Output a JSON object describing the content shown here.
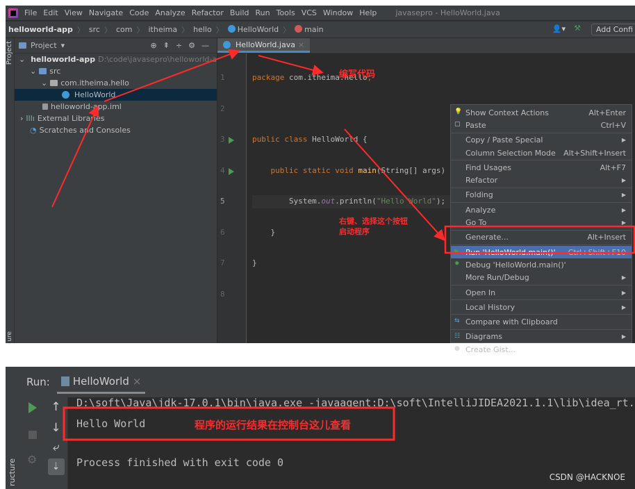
{
  "menubar": {
    "items": [
      "File",
      "Edit",
      "View",
      "Navigate",
      "Code",
      "Analyze",
      "Refactor",
      "Build",
      "Run",
      "Tools",
      "VCS",
      "Window",
      "Help"
    ],
    "window_title": "javasepro - HelloWorld.java"
  },
  "breadcrumb": [
    "helloworld-app",
    "src",
    "com",
    "itheima",
    "hello",
    "HelloWorld",
    "main"
  ],
  "toolbar": {
    "add_config": "Add Confi"
  },
  "sidebar": {
    "project_label": "Project",
    "structure_label": "ure"
  },
  "project": {
    "title": "Project",
    "root": "helloworld-app",
    "root_path": "D:\\code\\javasepro\\helloworld-app",
    "src": "src",
    "package": "com.itheima.hello",
    "class": "HelloWorld",
    "iml": "helloworld-app.iml",
    "ext_libs": "External Libraries",
    "scratches": "Scratches and Consoles"
  },
  "editor": {
    "tab": "HelloWorld.java",
    "line_numbers": [
      "1",
      "2",
      "3",
      "4",
      "5",
      "6",
      "7",
      "8"
    ],
    "code": {
      "l1a": "package",
      "l1b": " com.itheima.hello",
      "l1c": ";",
      "l3a": "public class",
      "l3b": " HelloWorld {",
      "l4a": "    public static void ",
      "l4b": "main",
      "l4c": "(String[] args) {",
      "l5a": "        System.",
      "l5b": "out",
      "l5c": ".println(",
      "l5d": "\"Hello World\"",
      "l5e": ");",
      "l6": "    }",
      "l7": "}"
    }
  },
  "annotations": {
    "write_code": "编写代码",
    "right_click": "右键、选择这个按钮",
    "start_program": "启动程序",
    "console_note": "程序的运行结果在控制台这儿查看"
  },
  "context_menu": [
    {
      "label": "Show Context Actions",
      "shortcut": "Alt+Enter",
      "icon": "bulb-icon"
    },
    {
      "label": "Paste",
      "shortcut": "Ctrl+V",
      "icon": "clipboard-icon"
    },
    {
      "label": "Copy / Paste Special",
      "submenu": true
    },
    {
      "label": "Column Selection Mode",
      "shortcut": "Alt+Shift+Insert"
    },
    {
      "label": "Find Usages",
      "shortcut": "Alt+F7"
    },
    {
      "label": "Refactor",
      "submenu": true
    },
    {
      "label": "Folding",
      "submenu": true
    },
    {
      "label": "Analyze",
      "submenu": true
    },
    {
      "label": "Go To",
      "submenu": true
    },
    {
      "label": "Generate...",
      "shortcut": "Alt+Insert"
    },
    {
      "label": "Run 'HelloWorld.main()'",
      "shortcut": "Ctrl+Shift+F10",
      "icon": "run-icon",
      "highlighted": true
    },
    {
      "label": "Debug 'HelloWorld.main()'",
      "icon": "debug-icon"
    },
    {
      "label": "More Run/Debug",
      "submenu": true
    },
    {
      "label": "Open In",
      "submenu": true
    },
    {
      "label": "Local History",
      "submenu": true
    },
    {
      "label": "Compare with Clipboard",
      "icon": "compare-icon"
    },
    {
      "label": "Diagrams",
      "submenu": true,
      "icon": "diagram-icon"
    },
    {
      "label": "Create Gist...",
      "icon": "github-icon"
    }
  ],
  "run": {
    "label": "Run:",
    "tab": "HelloWorld",
    "cmd": "D:\\soft\\Java\\jdk-17.0.1\\bin\\java.exe -javaagent:D:\\soft\\IntelliJIDEA2021.1.1\\lib\\idea_rt.",
    "output": "Hello World",
    "finished": "Process finished with exit code 0",
    "structure_label": "ructure"
  },
  "watermark": "CSDN @HACKNOE",
  "colors": {
    "annotation": "#ff2a2a",
    "highlight": "#4b6eaf",
    "run_green": "#499c54"
  }
}
